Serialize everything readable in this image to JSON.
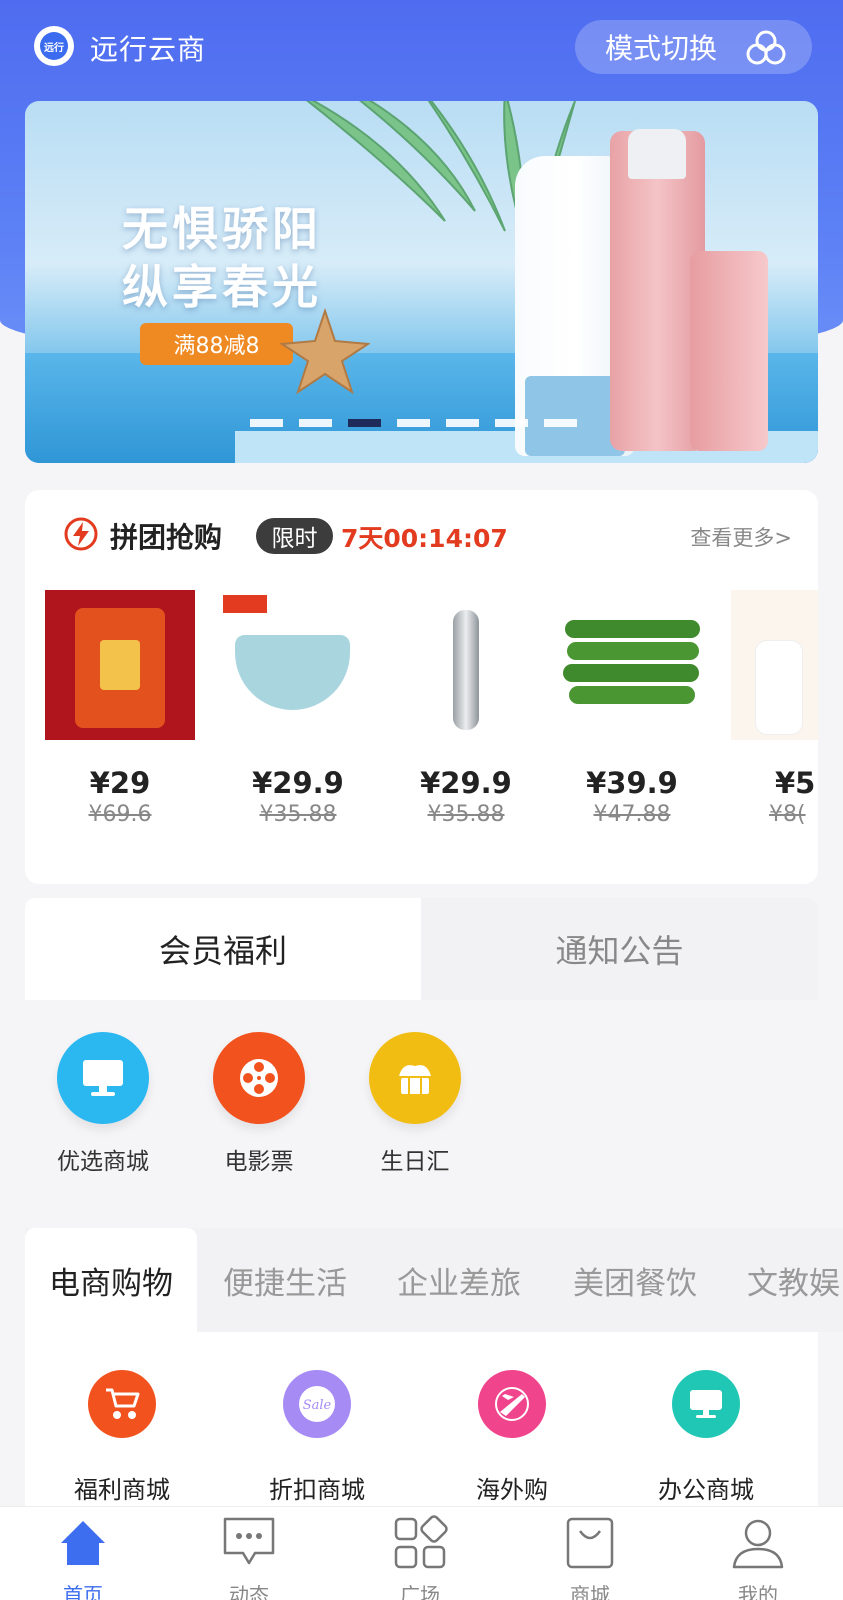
{
  "header": {
    "logo_text": "远行",
    "title": "远行云商",
    "mode_switch_label": "模式切换"
  },
  "banner": {
    "headline_1": "无惧骄阳",
    "headline_2": "纵享春光",
    "promo": "满88减8",
    "active_slide": 3,
    "slide_count": 7
  },
  "group_buy": {
    "title": "拼团抢购",
    "badge": "限时",
    "countdown": "7天00:14:07",
    "more_link": "查看更多>",
    "items": [
      {
        "price": "¥29",
        "original": "¥69.6"
      },
      {
        "price": "¥29.9",
        "original": "¥35.88"
      },
      {
        "price": "¥29.9",
        "original": "¥35.88"
      },
      {
        "price": "¥39.9",
        "original": "¥47.88"
      },
      {
        "price": "¥5",
        "original": "¥8("
      }
    ]
  },
  "member_tabs": {
    "active": "会员福利",
    "inactive": "通知公告"
  },
  "welfare_items": [
    {
      "label": "优选商城",
      "color": "#2bb7f0",
      "icon": "monitor-icon"
    },
    {
      "label": "电影票",
      "color": "#f2521e",
      "icon": "film-reel-icon"
    },
    {
      "label": "生日汇",
      "color": "#f2bd12",
      "icon": "cake-icon"
    }
  ],
  "category_tabs": [
    "电商购物",
    "便捷生活",
    "企业差旅",
    "美团餐饮",
    "文教娱"
  ],
  "shops": [
    {
      "label": "福利商城",
      "color": "#f2521e",
      "icon": "stroller-icon"
    },
    {
      "label": "折扣商城",
      "color": "#a78bf5",
      "icon": "sale-tag-icon",
      "icon_text": "Sale"
    },
    {
      "label": "海外购",
      "color": "#f0448c",
      "icon": "plane-icon"
    },
    {
      "label": "办公商城",
      "color": "#20c7b5",
      "icon": "monitor-icon"
    }
  ],
  "bottom_nav": [
    {
      "label": "首页",
      "icon": "home-icon",
      "active": true
    },
    {
      "label": "动态",
      "icon": "chat-bubble-icon",
      "active": false
    },
    {
      "label": "广场",
      "icon": "grid-apps-icon",
      "active": false
    },
    {
      "label": "商城",
      "icon": "shopping-bag-icon",
      "active": false
    },
    {
      "label": "我的",
      "icon": "user-icon",
      "active": false
    }
  ],
  "colors": {
    "brand_blue": "#4f6cf0",
    "countdown_red": "#e23b1f",
    "nav_active": "#3d6ef0",
    "promo_orange": "#ef8a22"
  }
}
